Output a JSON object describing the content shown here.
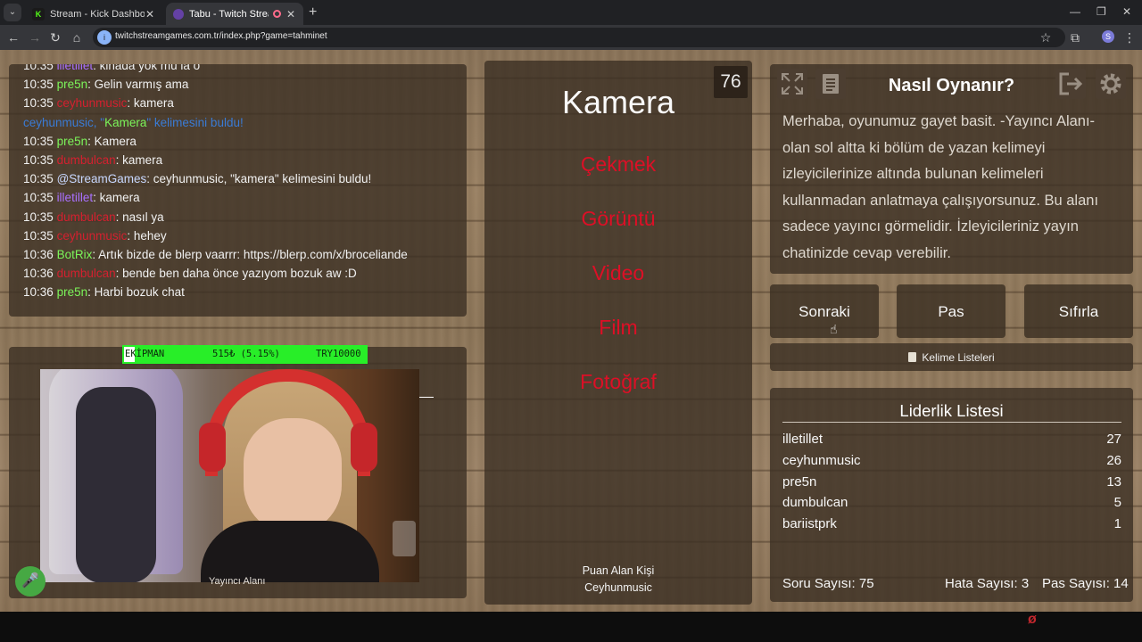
{
  "browser": {
    "tabs": [
      {
        "title": "Stream - Kick Dashboard",
        "icon": "kick-logo-icon"
      },
      {
        "title": "Tabu - Twitch Stream Games",
        "icon": "tabu-logo-icon",
        "recording": true
      }
    ],
    "url": "twitchstreamgames.com.tr/index.php?game=tahminet",
    "profile_initial": "S"
  },
  "chat": {
    "messages": [
      {
        "time": "10:35",
        "user": "illetillet",
        "color": "purple",
        "text": ": kinada yok mu la o"
      },
      {
        "time": "10:35",
        "user": "pre5n",
        "color": "green",
        "text": ": Gelin varmış ama"
      },
      {
        "time": "10:35",
        "user": "ceyhunmusic",
        "color": "red",
        "text": ": kamera"
      },
      {
        "time": "",
        "user": "ceyhunmusic",
        "color": "blue",
        "system": true,
        "prefix": ", \"",
        "word": "Kamera",
        "suffix": "\" kelimesini buldu!"
      },
      {
        "time": "10:35",
        "user": "pre5n",
        "color": "green",
        "text": ": Kamera"
      },
      {
        "time": "10:35",
        "user": "dumbulcan",
        "color": "red",
        "text": ": kamera"
      },
      {
        "time": "10:35",
        "user": "@StreamGames",
        "color": "sg",
        "text": ": ceyhunmusic, \"kamera\" kelimesini buldu!"
      },
      {
        "time": "10:35",
        "user": "illetillet",
        "color": "purple",
        "text": ": kamera"
      },
      {
        "time": "10:35",
        "user": "dumbulcan",
        "color": "red",
        "text": ": nasıl ya"
      },
      {
        "time": "10:35",
        "user": "ceyhunmusic",
        "color": "red",
        "text": ": hehey"
      },
      {
        "time": "10:36",
        "user": "BotRix",
        "color": "green",
        "text": ": Artık bizde de blerp vaarrr: https://blerp.com/x/broceliande"
      },
      {
        "time": "10:36",
        "user": "dumbulcan",
        "color": "red",
        "text": ": bende ben daha önce yazıyom bozuk aw :D"
      },
      {
        "time": "10:36",
        "user": "pre5n",
        "color": "green",
        "text": ": Harbi bozuk chat"
      }
    ]
  },
  "ticker": {
    "item": "EKİPMAN",
    "amount": "515₺ (5.15%)",
    "goal": "TRY10000"
  },
  "streamer_area_label": "Yayıncı Alanı",
  "card": {
    "timer": "76",
    "main_word": "Kamera",
    "taboo_words": [
      "Çekmek",
      "Görüntü",
      "Video",
      "Film",
      "Fotoğraf"
    ],
    "scorer_label": "Puan Alan Kişi",
    "scorer_name": "Ceyhunmusic"
  },
  "help": {
    "title": "Nasıl Oynanır?",
    "text": "Merhaba, oyunumuz gayet basit. -Yayıncı Alanı- olan sol altta ki bölüm de yazan kelimeyi izleyicilerinize altında bulunan kelimeleri kullanmadan anlatmaya çalışıyorsunuz. Bu alanı sadece yayıncı görmelidir. İzleyicileriniz yayın chatinizde cevap verebilir."
  },
  "actions": {
    "next": "Sonraki",
    "pass": "Pas",
    "reset": "Sıfırla"
  },
  "word_lists_label": "Kelime Listeleri",
  "leaderboard": {
    "title": "Liderlik Listesi",
    "rows": [
      {
        "name": "illetillet",
        "score": "27"
      },
      {
        "name": "ceyhunmusic",
        "score": "26"
      },
      {
        "name": "pre5n",
        "score": "13"
      },
      {
        "name": "dumbulcan",
        "score": "5"
      },
      {
        "name": "bariistprk",
        "score": "1"
      }
    ]
  },
  "stats": {
    "questions": "Soru Sayısı: 75",
    "errors": "Hata Sayısı: 3",
    "passes": "Pas Sayısı: 14"
  },
  "colors": {
    "taboo": "#dd0f26",
    "ticker": "#28ee28",
    "nick_green": "#7cf55a",
    "nick_purple": "#a970ff",
    "nick_red": "#d4202f",
    "nick_blue": "#3a7bd5"
  }
}
